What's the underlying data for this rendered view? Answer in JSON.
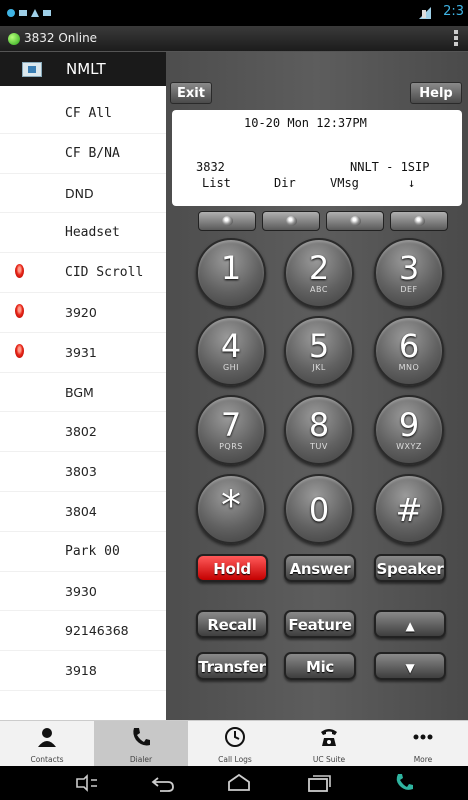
{
  "status_bar": {
    "time": "2:3",
    "colors": {
      "time": "#3fb4e4",
      "online": "#2aa51a"
    }
  },
  "app_bar": {
    "title": "3832 Online"
  },
  "sidebar": {
    "header": "NMLT",
    "items": [
      {
        "label": "CF All",
        "led": false
      },
      {
        "label": "CF B/NA",
        "led": false
      },
      {
        "label": "DND",
        "led": false
      },
      {
        "label": "Headset",
        "led": false
      },
      {
        "label": "CID Scroll",
        "led": true
      },
      {
        "label": "3920",
        "led": true
      },
      {
        "label": "3931",
        "led": true
      },
      {
        "label": "BGM",
        "led": false
      },
      {
        "label": "3802",
        "led": false
      },
      {
        "label": "3803",
        "led": false
      },
      {
        "label": "3804",
        "led": false
      },
      {
        "label": "Park 00",
        "led": false
      },
      {
        "label": "3930",
        "led": false
      },
      {
        "label": "92146368",
        "led": false
      },
      {
        "label": "3918",
        "led": false
      }
    ]
  },
  "phone": {
    "exit_label": "Exit",
    "help_label": "Help",
    "lcd": {
      "datetime": "10-20 Mon 12:37PM",
      "extension": "3832",
      "line_name": "NNLT - 1SIP",
      "softkeys": [
        "List",
        "Dir",
        "VMsg",
        "↓"
      ]
    },
    "keypad": [
      {
        "digit": "1",
        "letters": ""
      },
      {
        "digit": "2",
        "letters": "ABC"
      },
      {
        "digit": "3",
        "letters": "DEF"
      },
      {
        "digit": "4",
        "letters": "GHI"
      },
      {
        "digit": "5",
        "letters": "JKL"
      },
      {
        "digit": "6",
        "letters": "MNO"
      },
      {
        "digit": "7",
        "letters": "PQRS"
      },
      {
        "digit": "8",
        "letters": "TUV"
      },
      {
        "digit": "9",
        "letters": "WXYZ"
      },
      {
        "digit": "*",
        "letters": ""
      },
      {
        "digit": "0",
        "letters": ""
      },
      {
        "digit": "#",
        "letters": ""
      }
    ],
    "function_buttons": {
      "hold": "Hold",
      "answer": "Answer",
      "speaker": "Speaker",
      "recall": "Recall",
      "feature": "Feature",
      "up": "▲",
      "transfer": "Transfer",
      "mic": "Mic",
      "down": "▼"
    },
    "colors": {
      "hold": "#e01010",
      "lcd": "#ffffff"
    }
  },
  "tabbar": {
    "tabs": [
      {
        "label": "Contacts",
        "icon": "person-icon",
        "active": false
      },
      {
        "label": "Dialer",
        "icon": "phone-handset-icon",
        "active": true
      },
      {
        "label": "Call Logs",
        "icon": "clock-icon",
        "active": false
      },
      {
        "label": "UC Suite",
        "icon": "phone-stand-icon",
        "active": false
      },
      {
        "label": "More",
        "icon": "more-dots-icon",
        "active": false
      }
    ]
  },
  "navbar": {
    "icons": [
      "menu-icon",
      "back-icon",
      "home-icon",
      "recents-icon",
      "phone-icon"
    ]
  }
}
